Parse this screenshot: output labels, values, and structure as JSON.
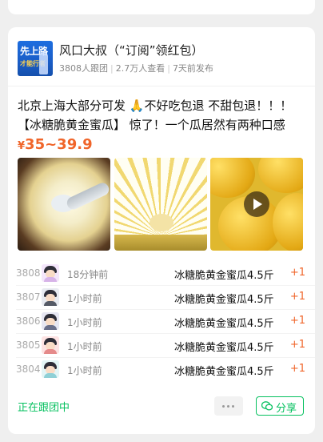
{
  "header": {
    "avatar_text_main": "先上路",
    "avatar_text_sub": "才能行者",
    "title": "风口大叔（“订阅”领红包）",
    "followers": "3808人跟团",
    "views": "2.7万人查看",
    "posted": "7天前发布"
  },
  "post": {
    "line1": "北京上海大部分可发 🙏不好吃包退 不甜包退！！！",
    "line2": "【冰糖脆黄金蜜瓜】 惊了！一个瓜居然有两种口感",
    "price_symbol": "¥",
    "price_range": "35~39.9"
  },
  "photos": [
    {
      "name": "melon-spoon-photo"
    },
    {
      "name": "melon-slices-photo"
    },
    {
      "name": "melon-video-thumbnail"
    }
  ],
  "orders": [
    {
      "no": "3808",
      "time": "18分钟前",
      "item": "冰糖脆黄金蜜瓜4.5斤",
      "qty": "+1",
      "body_color": "#d7b3e8",
      "bg": "#f4e6fb"
    },
    {
      "no": "3807",
      "time": "1小时前",
      "item": "冰糖脆黄金蜜瓜4.5斤",
      "qty": "+1",
      "body_color": "#555a66",
      "bg": "#e8ebf1"
    },
    {
      "no": "3806",
      "time": "1小时前",
      "item": "冰糖脆黄金蜜瓜4.5斤",
      "qty": "+1",
      "body_color": "#6a6f8a",
      "bg": "#e6e6f2"
    },
    {
      "no": "3805",
      "time": "1小时前",
      "item": "冰糖脆黄金蜜瓜4.5斤",
      "qty": "+1",
      "body_color": "#e58a8a",
      "bg": "#fde3e3"
    },
    {
      "no": "3804",
      "time": "1小时前",
      "item": "冰糖脆黄金蜜瓜4.5斤",
      "qty": "+1",
      "body_color": "#8fd0d6",
      "bg": "#e3f5f6"
    }
  ],
  "footer": {
    "status": "正在跟团中",
    "more_icon": "more-dots-icon",
    "share_icon": "wechat-icon",
    "share_label": "分享"
  },
  "colors": {
    "accent_green": "#07c160",
    "price_orange": "#f0652a"
  }
}
